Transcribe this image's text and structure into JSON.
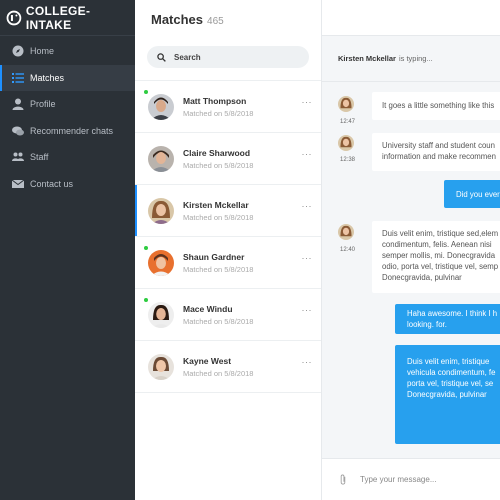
{
  "brand": {
    "name": "COLLEGE-INTAKE"
  },
  "sidebar": {
    "items": [
      {
        "label": "Home",
        "icon": "compass-icon"
      },
      {
        "label": "Matches",
        "icon": "list-icon",
        "active": true
      },
      {
        "label": "Profile",
        "icon": "person-icon"
      },
      {
        "label": "Recommender chats",
        "icon": "chat-bubbles-icon"
      },
      {
        "label": "Staff",
        "icon": "people-icon"
      },
      {
        "label": "Contact us",
        "icon": "envelope-icon"
      }
    ]
  },
  "matches": {
    "title": "Matches",
    "count": "465",
    "search_placeholder": "Search",
    "items": [
      {
        "name": "Matt Thompson",
        "sub": "Matched on 5/8/2018",
        "online": true
      },
      {
        "name": "Claire Sharwood",
        "sub": "Matched on 5/8/2018",
        "online": false
      },
      {
        "name": "Kirsten Mckellar",
        "sub": "Matched on 5/8/2018",
        "online": false,
        "selected": true
      },
      {
        "name": "Shaun Gardner",
        "sub": "Matched on 5/8/2018",
        "online": true
      },
      {
        "name": "Mace Windu",
        "sub": "Matched on 5/8/2018",
        "online": true
      },
      {
        "name": "Kayne West",
        "sub": "Matched on 5/8/2018",
        "online": false
      }
    ],
    "more_label": "···"
  },
  "chat": {
    "typing_name": "Kirsten Mckellar",
    "typing_text": "is typing...",
    "messages": [
      {
        "from": "in",
        "time": "12:47",
        "lines": [
          "It goes a little something like this"
        ]
      },
      {
        "from": "in",
        "time": "12:38",
        "lines": [
          "University staff and student coun",
          "information and make recommen"
        ]
      },
      {
        "from": "out",
        "lines": [
          "Did you ever"
        ]
      },
      {
        "from": "in",
        "time": "12:40",
        "lines": [
          "Duis velit enim, tristique  sed,elem",
          "condimentum, felis. Aenean nisi",
          "semper mollis, mi.  Donecgravida",
          "odio, porta vel, tristique vel, semp",
          "Donecgravida, pulvinar"
        ]
      },
      {
        "from": "out",
        "lines": [
          "Haha awesome.  I think I h",
          "looking. for."
        ]
      },
      {
        "from": "out",
        "lines": [
          "Duis velit enim, tristique",
          "vehicula condimentum, fe",
          "porta vel, tristique vel, se",
          "Donecgravida, pulvinar"
        ]
      }
    ],
    "composer_placeholder": "Type your message..."
  },
  "colors": {
    "sidebar": "#2b3137",
    "accent": "#1e90ff",
    "bubble_out": "#27a0ee",
    "online": "#2ecc40"
  }
}
